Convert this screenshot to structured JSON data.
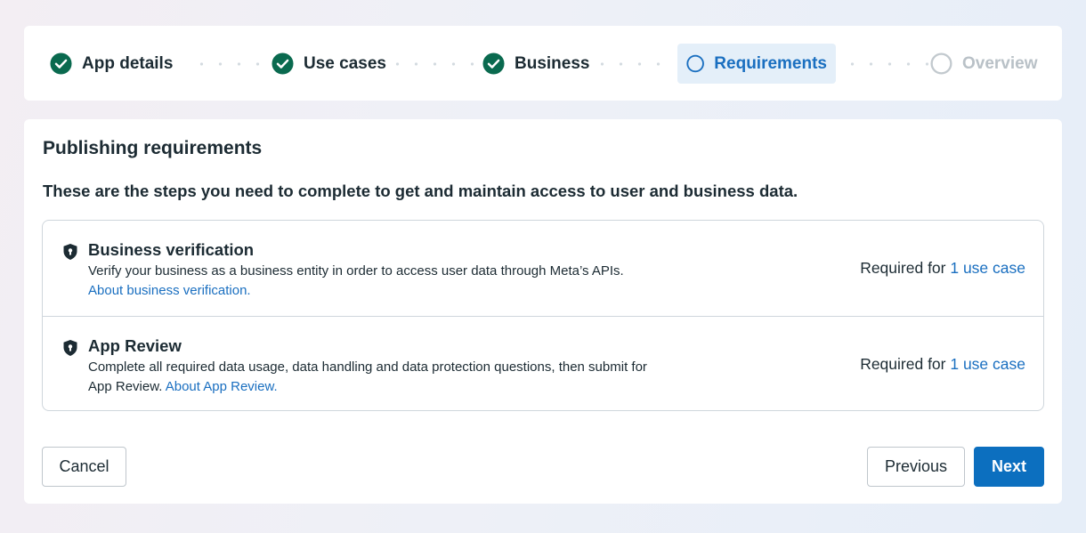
{
  "stepper": {
    "steps": [
      {
        "label": "App details",
        "status": "complete"
      },
      {
        "label": "Use cases",
        "status": "complete"
      },
      {
        "label": "Business",
        "status": "complete"
      },
      {
        "label": "Requirements",
        "status": "current"
      },
      {
        "label": "Overview",
        "status": "upcoming"
      }
    ],
    "icons": {
      "complete": "check-circle-icon",
      "current": "open-circle-icon",
      "upcoming": "empty-circle-icon"
    }
  },
  "main": {
    "title": "Publishing requirements",
    "subtitle": "These are the steps you need to complete to get and maintain access to user and business data.",
    "requirements": [
      {
        "name": "Business verification",
        "description": "Verify your business as a business entity in order to access user data through Meta’s APIs.",
        "link_text": "About business verification.",
        "required_prefix": "Required for ",
        "required_link": "1 use case",
        "icon": "shield-lock-icon"
      },
      {
        "name": "App Review",
        "description": "Complete all required data usage, data handling and data protection questions, then submit for App Review.",
        "link_text": "About App Review.",
        "required_prefix": "Required for ",
        "required_link": "1 use case",
        "icon": "shield-lock-icon"
      }
    ]
  },
  "footer": {
    "cancel_label": "Cancel",
    "previous_label": "Previous",
    "next_label": "Next"
  },
  "colors": {
    "accent": "#0c6fbf",
    "complete": "#0a6a4f",
    "current_bg": "#e4eff9",
    "upcoming": "#c2c9ce"
  }
}
